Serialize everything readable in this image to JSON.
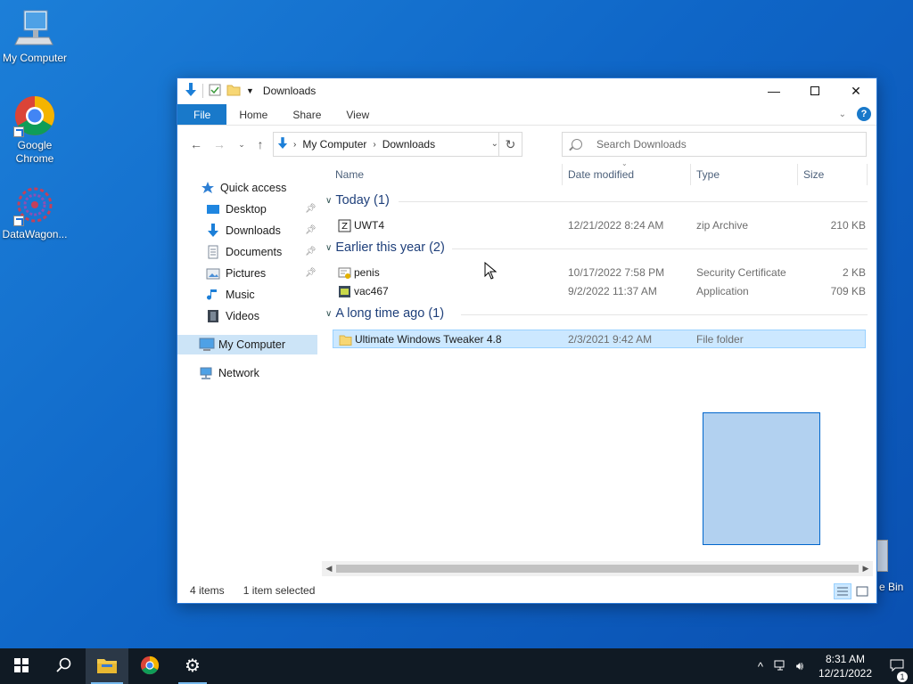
{
  "desktop": {
    "icons": [
      {
        "label": "My Computer",
        "icon": "computer-monitor-icon"
      },
      {
        "label": "Google Chrome",
        "icon": "chrome-icon"
      },
      {
        "label": "DataWagon...",
        "icon": "datawagon-icon"
      }
    ],
    "recycle_bin_label": "e Bin"
  },
  "window": {
    "title": "Downloads",
    "ribbon_tabs": [
      "File",
      "Home",
      "Share",
      "View"
    ],
    "breadcrumb": [
      "My Computer",
      "Downloads"
    ],
    "search_placeholder": "Search Downloads",
    "columns": [
      "Name",
      "Date modified",
      "Type",
      "Size"
    ],
    "nav_pane": {
      "quick_access": "Quick access",
      "items": [
        {
          "label": "Desktop",
          "pinned": true
        },
        {
          "label": "Downloads",
          "pinned": true
        },
        {
          "label": "Documents",
          "pinned": true
        },
        {
          "label": "Pictures",
          "pinned": true
        },
        {
          "label": "Music",
          "pinned": false
        },
        {
          "label": "Videos",
          "pinned": false
        }
      ],
      "my_computer": "My Computer",
      "network": "Network"
    },
    "groups": [
      {
        "label": "Today (1)",
        "files": [
          {
            "name": "UWT4",
            "date": "12/21/2022 8:24 AM",
            "type": "zip Archive",
            "size": "210 KB",
            "icon": "zip-archive-icon"
          }
        ]
      },
      {
        "label": "Earlier this year (2)",
        "files": [
          {
            "name": "penis",
            "date": "10/17/2022 7:58 PM",
            "type": "Security Certificate",
            "size": "2 KB",
            "icon": "certificate-icon"
          },
          {
            "name": "vac467",
            "date": "9/2/2022 11:37 AM",
            "type": "Application",
            "size": "709 KB",
            "icon": "application-icon"
          }
        ]
      },
      {
        "label": "A long time ago (1)",
        "files": [
          {
            "name": "Ultimate Windows Tweaker 4.8",
            "date": "2/3/2021 9:42 AM",
            "type": "File folder",
            "size": "",
            "icon": "folder-icon"
          }
        ]
      }
    ],
    "status": {
      "count": "4 items",
      "selected": "1 item selected"
    }
  },
  "taskbar": {
    "time": "8:31 AM",
    "date": "12/21/2022",
    "notification_count": "1"
  },
  "colors": {
    "accent": "#1979ca",
    "selection": "#cce8ff",
    "taskbar": "#101a24"
  }
}
